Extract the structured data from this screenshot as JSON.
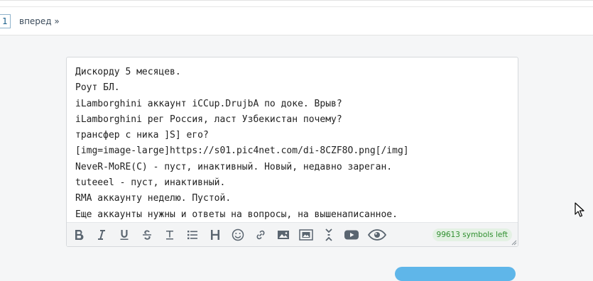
{
  "pagination": {
    "current_page": "1",
    "next_label": "вперед »"
  },
  "editor": {
    "lines": [
      "Дискорду 5 месяцев.",
      "Роут БЛ.",
      "iLamborghini аккаунт iCCup.DrujbA по доке. Врыв?",
      "iLamborghini рег Россия, ласт Узбекистан почему?",
      "трансфер с ника ]S] его?",
      "[img=image-large]https://s01.pic4net.com/di-8CZF8O.png[/img]",
      "NeveR-MoRE(C) - пуст, инактивный. Новый, недавно зареган.",
      "tuteeel - пуст, инактивный.",
      "RMA аккаунту неделю. Пустой.",
      "Еще аккаунты нужны и ответы на вопросы, на вышенаписанное."
    ],
    "symbols_left": "99613 symbols left"
  },
  "toolbar_icons": [
    "bold-icon",
    "italic-icon",
    "underline-icon",
    "strikethrough-icon",
    "center-align-icon",
    "bulleted-list-icon",
    "heading-icon",
    "emoji-icon",
    "link-icon",
    "image-icon",
    "gallery-icon",
    "collapse-icon",
    "youtube-icon",
    "preview-eye-icon"
  ],
  "colors": {
    "accent_blue": "#5fb6e9",
    "counter_green": "#2f8f2f",
    "counter_bg": "#e4f1e4"
  }
}
